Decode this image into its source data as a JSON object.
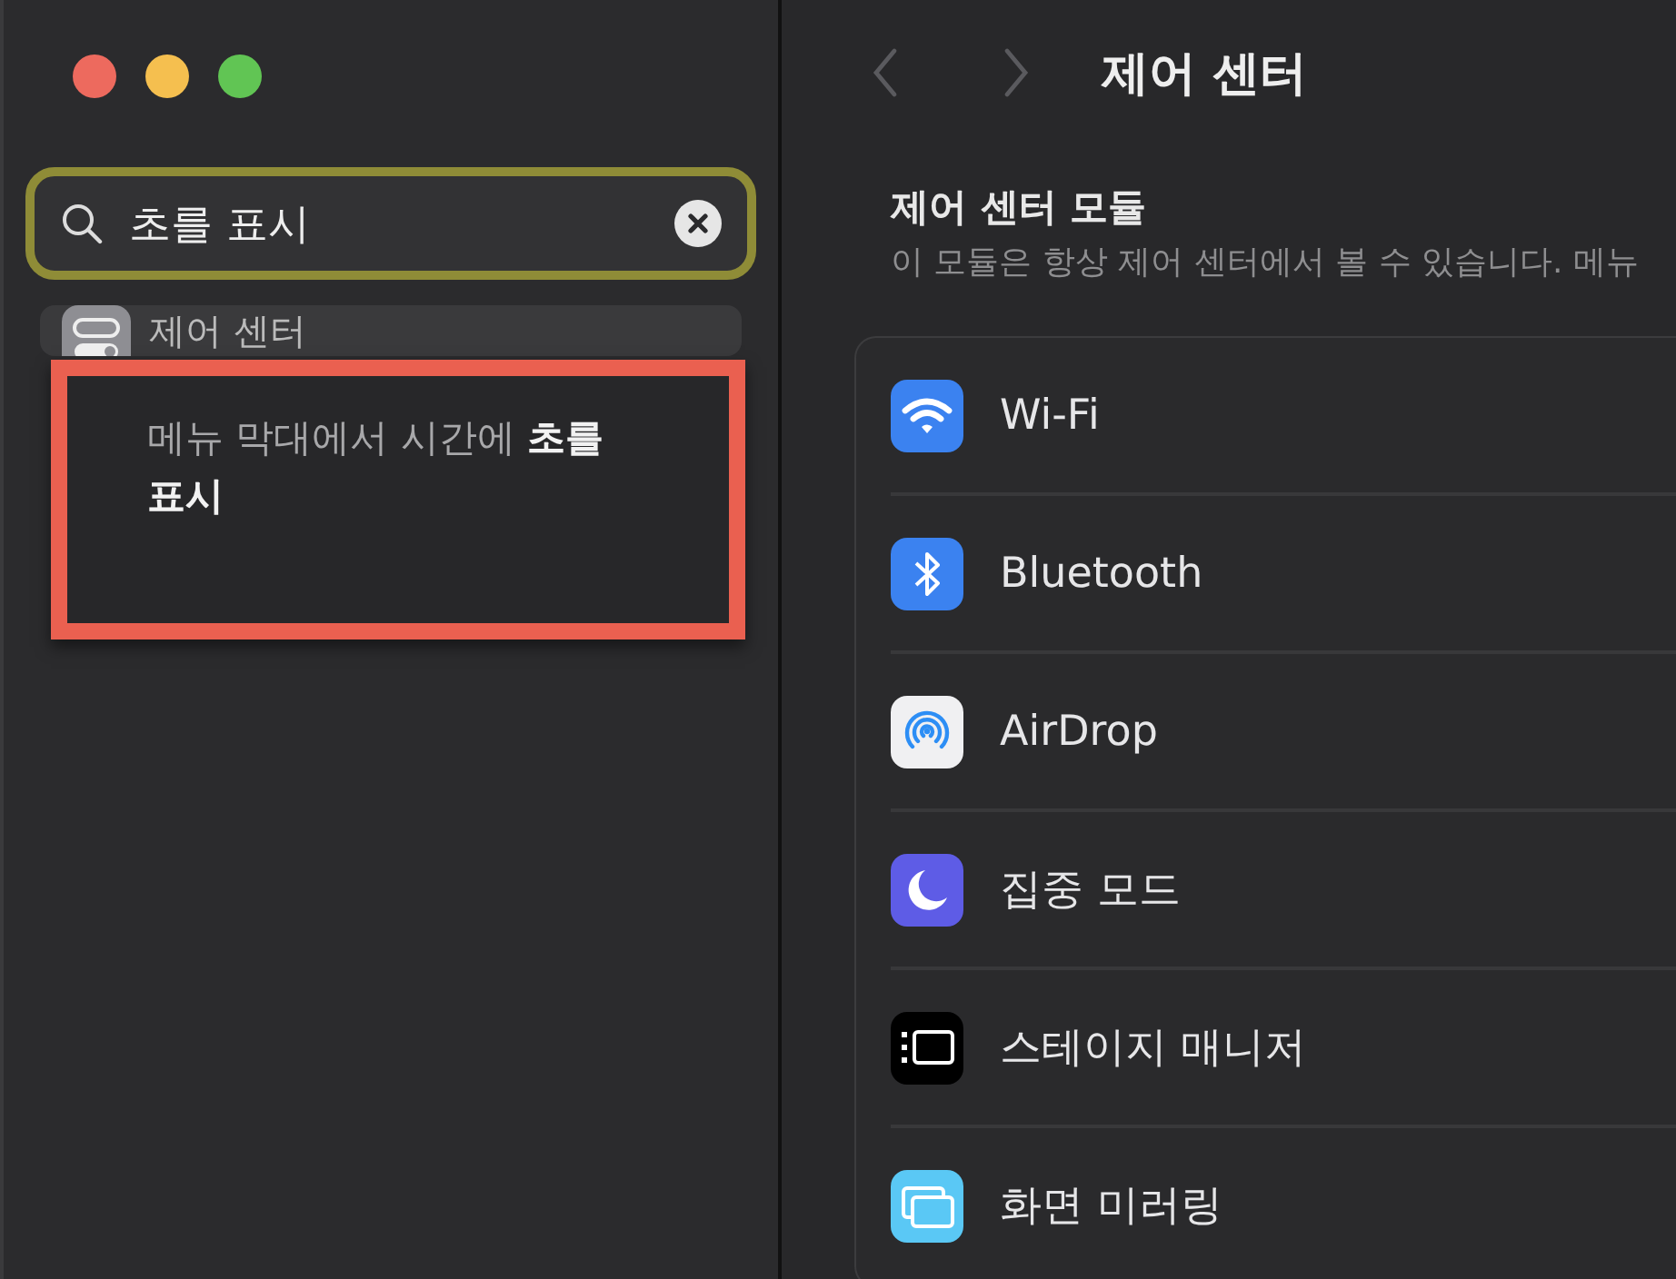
{
  "window": {
    "title": "제어 센터"
  },
  "search": {
    "value": "초를 표시"
  },
  "sidebar": {
    "items": [
      {
        "label": "제어 센터"
      }
    ]
  },
  "tooltip": {
    "text": "메뉴 막대에서 시간에 **초를 표시**"
  },
  "section": {
    "title": "제어 센터 모듈",
    "subtitle": "이 모듈은 항상 제어 센터에서 볼 수 있습니다. 메뉴"
  },
  "modules": [
    {
      "kind": "wifi",
      "label": "Wi-Fi"
    },
    {
      "kind": "bluetooth",
      "label": "Bluetooth"
    },
    {
      "kind": "airdrop",
      "label": "AirDrop"
    },
    {
      "kind": "focus",
      "label": "집중 모드"
    },
    {
      "kind": "stage",
      "label": "스테이지 매니저"
    },
    {
      "kind": "mirroring",
      "label": "화면 미러링"
    }
  ]
}
